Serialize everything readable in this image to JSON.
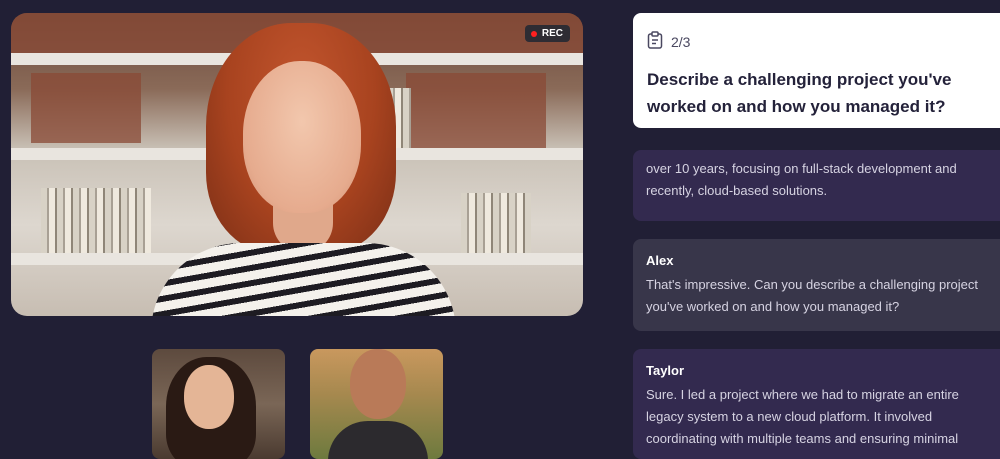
{
  "video": {
    "rec_label": "REC"
  },
  "question": {
    "progress": "2/3",
    "text": "Describe a challenging project you've worked on and how you managed it?"
  },
  "messages": [
    {
      "name": "",
      "text": "over 10 years, focusing on full-stack development and recently, cloud-based solutions."
    },
    {
      "name": "Alex",
      "text": "That's impressive. Can you describe a challenging project you've worked on and how you managed it?"
    },
    {
      "name": "Taylor",
      "text": "Sure. I led a project where we had to migrate an entire legacy system to a new cloud platform. It involved coordinating with multiple teams and ensuring minimal"
    }
  ],
  "colors": {
    "background": "#211f35",
    "card": "#ffffff",
    "message_user": "#332a4f",
    "message_interviewer": "#38364a",
    "rec_dot": "#ff2020"
  },
  "icons": {
    "question": "clipboard-icon",
    "recording": "record-dot-icon"
  }
}
